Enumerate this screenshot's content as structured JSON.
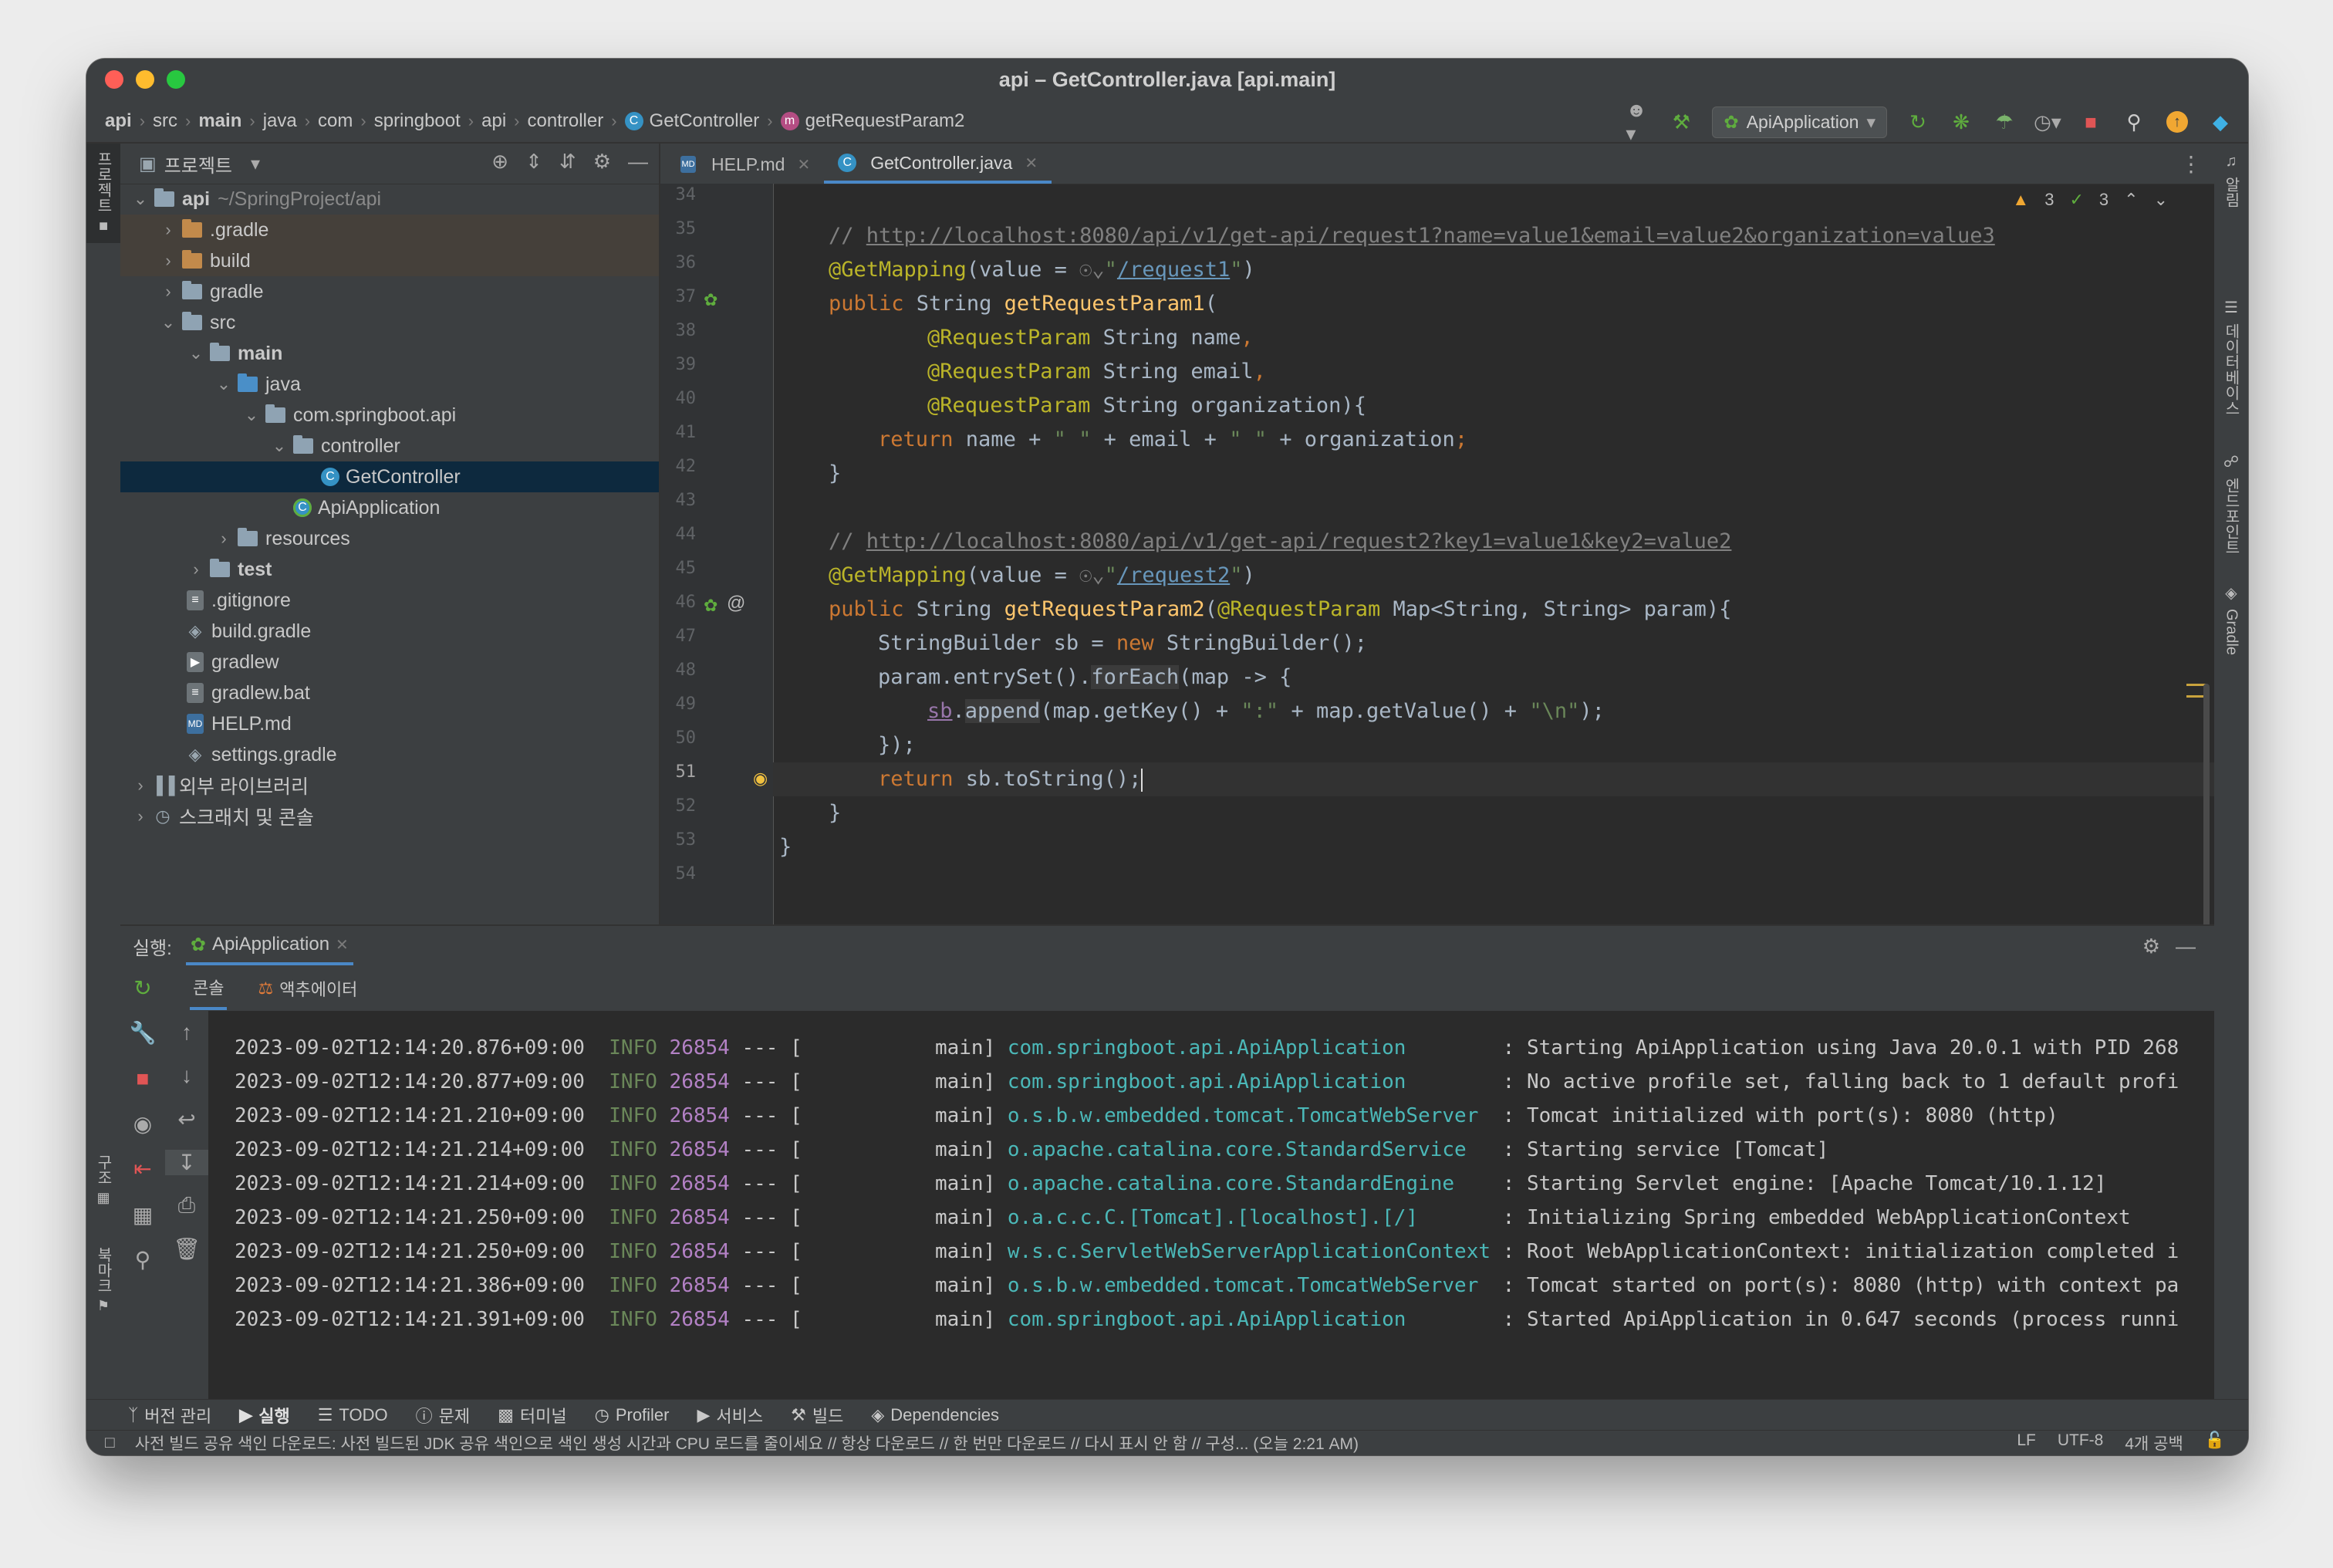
{
  "window": {
    "title": "api – GetController.java [api.main]"
  },
  "breadcrumb": [
    "api",
    "src",
    "main",
    "java",
    "com",
    "springboot",
    "api",
    "controller",
    "GetController",
    "getRequestParam2"
  ],
  "toolbar": {
    "run_config": "ApiApplication"
  },
  "left_strip": {
    "project_label": "프로젝트",
    "structure_label": "구조",
    "bookmarks_label": "북마크"
  },
  "right_strip": {
    "notifications_label": "알림",
    "database_label": "데이터베이스",
    "endpoints_label": "엔드포인트",
    "gradle_label": "Gradle"
  },
  "project": {
    "header": "프로젝트",
    "tree": [
      {
        "label": "api",
        "note": "~/SpringProject/api"
      },
      {
        "label": ".gradle"
      },
      {
        "label": "build"
      },
      {
        "label": "gradle"
      },
      {
        "label": "src"
      },
      {
        "label": "main"
      },
      {
        "label": "java"
      },
      {
        "label": "com.springboot.api"
      },
      {
        "label": "controller"
      },
      {
        "label": "GetController"
      },
      {
        "label": "ApiApplication"
      },
      {
        "label": "resources"
      },
      {
        "label": "test"
      },
      {
        "label": ".gitignore"
      },
      {
        "label": "build.gradle"
      },
      {
        "label": "gradlew"
      },
      {
        "label": "gradlew.bat"
      },
      {
        "label": "HELP.md"
      },
      {
        "label": "settings.gradle"
      },
      {
        "label": "외부 라이브러리"
      },
      {
        "label": "스크래치 및 콘솔"
      }
    ]
  },
  "editor": {
    "tabs": [
      "HELP.md",
      "GetController.java"
    ],
    "inspections": {
      "warnings": "3",
      "typos": "3"
    },
    "line_numbers": [
      "34",
      "35",
      "36",
      "37",
      "38",
      "39",
      "40",
      "41",
      "42",
      "43",
      "44",
      "45",
      "46",
      "47",
      "48",
      "49",
      "50",
      "51",
      "52",
      "53",
      "54"
    ],
    "code": {
      "l35_comment": "// ",
      "l35_url": "http://localhost:8080/api/v1/get-api/request1?name=value1&email=value2&organization=value3",
      "l36_anno": "@GetMapping",
      "l36_rest": "(value = ",
      "l36_path": "/request1",
      "l37_kw": "public ",
      "l37_type": "String ",
      "l37_fn": "getRequestParam1",
      "l38_anno": "@RequestParam",
      "l38_rest": " String name",
      "l39_anno": "@RequestParam",
      "l39_rest": " String email",
      "l40_anno": "@RequestParam",
      "l40_rest": " String organization){",
      "l41_kw": "return ",
      "l41_rest_a": "name + ",
      "l41_str": "\" \"",
      "l41_rest_b": " + email + ",
      "l41_str2": "\" \"",
      "l41_rest_c": " + organization",
      "l42": "}",
      "l44_comment": "// ",
      "l44_url": "http://localhost:8080/api/v1/get-api/request2?key1=value1&key2=value2",
      "l45_anno": "@GetMapping",
      "l45_rest": "(value = ",
      "l45_path": "/request2",
      "l46_kw": "public ",
      "l46_type": "String ",
      "l46_fn": "getRequestParam2",
      "l46_anno": "@RequestParam",
      "l46_rest": " Map<String, String> param){",
      "l47_a": "StringBuilder sb = ",
      "l47_kw": "new ",
      "l47_b": "StringBuilder();",
      "l48_a": "param.entrySet().",
      "l48_fe": "forEach",
      "l48_b": "(map -> {",
      "l49_field": "sb",
      "l49_dot": ".",
      "l49_append": "append",
      "l49_a": "(map.getKey() + ",
      "l49_str": "\":\"",
      "l49_b": " + map.getValue() + ",
      "l49_str2": "\"\\n\"",
      "l49_c": ");",
      "l50": "});",
      "l51_kw": "return ",
      "l51_rest": "sb.toString();",
      "l52": "}",
      "l53": "}"
    }
  },
  "run": {
    "label": "실행:",
    "config": "ApiApplication",
    "tabs": [
      "콘솔",
      "액추에이터"
    ],
    "log": [
      {
        "ts": "2023-09-02T12:14:20.876+09:00",
        "level": "INFO",
        "pid": "26854",
        "thread": "main",
        "logger": "com.springboot.api.ApiApplication",
        "msg": ": Starting ApiApplication using Java 20.0.1 with PID 268"
      },
      {
        "ts": "2023-09-02T12:14:20.877+09:00",
        "level": "INFO",
        "pid": "26854",
        "thread": "main",
        "logger": "com.springboot.api.ApiApplication",
        "msg": ": No active profile set, falling back to 1 default profi"
      },
      {
        "ts": "2023-09-02T12:14:21.210+09:00",
        "level": "INFO",
        "pid": "26854",
        "thread": "main",
        "logger": "o.s.b.w.embedded.tomcat.TomcatWebServer",
        "msg": ": Tomcat initialized with port(s): 8080 (http)"
      },
      {
        "ts": "2023-09-02T12:14:21.214+09:00",
        "level": "INFO",
        "pid": "26854",
        "thread": "main",
        "logger": "o.apache.catalina.core.StandardService",
        "msg": ": Starting service [Tomcat]"
      },
      {
        "ts": "2023-09-02T12:14:21.214+09:00",
        "level": "INFO",
        "pid": "26854",
        "thread": "main",
        "logger": "o.apache.catalina.core.StandardEngine",
        "msg": ": Starting Servlet engine: [Apache Tomcat/10.1.12]"
      },
      {
        "ts": "2023-09-02T12:14:21.250+09:00",
        "level": "INFO",
        "pid": "26854",
        "thread": "main",
        "logger": "o.a.c.c.C.[Tomcat].[localhost].[/]",
        "msg": ": Initializing Spring embedded WebApplicationContext"
      },
      {
        "ts": "2023-09-02T12:14:21.250+09:00",
        "level": "INFO",
        "pid": "26854",
        "thread": "main",
        "logger": "w.s.c.ServletWebServerApplicationContext",
        "msg": ": Root WebApplicationContext: initialization completed i"
      },
      {
        "ts": "2023-09-02T12:14:21.386+09:00",
        "level": "INFO",
        "pid": "26854",
        "thread": "main",
        "logger": "o.s.b.w.embedded.tomcat.TomcatWebServer",
        "msg": ": Tomcat started on port(s): 8080 (http) with context pa"
      },
      {
        "ts": "2023-09-02T12:14:21.391+09:00",
        "level": "INFO",
        "pid": "26854",
        "thread": "main",
        "logger": "com.springboot.api.ApiApplication",
        "msg": ": Started ApiApplication in 0.647 seconds (process runni"
      }
    ]
  },
  "bottom_tabs": [
    "버전 관리",
    "실행",
    "TODO",
    "문제",
    "터미널",
    "Profiler",
    "서비스",
    "빌드",
    "Dependencies"
  ],
  "status": {
    "message": "사전 빌드 공유 색인 다운로드: 사전 빌드된 JDK 공유 색인으로 색인 생성 시간과 CPU 로드를 줄이세요 // 항상 다운로드 // 한 번만 다운로드 // 다시 표시 안 함 // 구성... (오늘 2:21 AM)",
    "line_sep": "LF",
    "encoding": "UTF-8",
    "indent": "4개 공백"
  },
  "colors": {
    "accent": "#4a88c7",
    "selection": "#0d293e",
    "keyword": "#cc7832",
    "annotation": "#bbb529",
    "function": "#ffc66d",
    "string": "#6a8759"
  }
}
